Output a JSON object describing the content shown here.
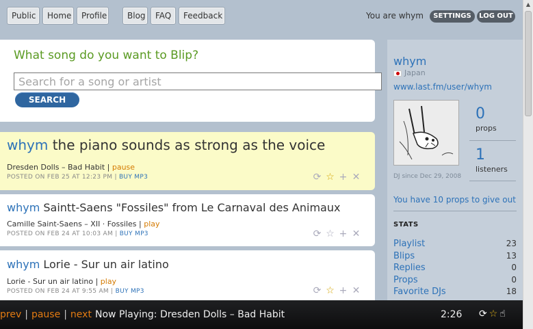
{
  "nav": {
    "public": "Public",
    "home": "Home",
    "profile": "Profile",
    "blog": "Blog",
    "faq": "FAQ",
    "feedback": "Feedback",
    "greeting": "You are whym",
    "settings": "SETTINGS",
    "logout": "LOG OUT"
  },
  "search": {
    "heading": "What song do you want to Blip?",
    "placeholder": "Search for a song or artist",
    "button": "SEARCH"
  },
  "posts": [
    {
      "dj": "whym",
      "message": "the piano sounds as strong as the voice",
      "song": "Dresden Dolls – Bad Habit",
      "action": "pause",
      "posted": "POSTED ON FEB 25 AT 12:23 PM",
      "buy": "BUY MP3",
      "favorited": true
    },
    {
      "dj": "whym",
      "message": "Saintt-Saens \"Fossiles\" from Le Carnaval des Animaux",
      "song": "Camille Saint-Saens – XII · Fossiles",
      "action": "play",
      "posted": "POSTED ON FEB 24 AT 10:03 AM",
      "buy": "BUY MP3",
      "favorited": false
    },
    {
      "dj": "whym",
      "message": "Lorie - Sur un air latino",
      "song": "Lorie - Sur un air latino",
      "action": "play",
      "posted": "POSTED ON FEB 24 AT 9:55 AM",
      "buy": "BUY MP3",
      "favorited": true
    }
  ],
  "sidebar": {
    "name": "whym",
    "country": "Japan",
    "lastfm": "www.last.fm/user/whym",
    "props_count": "0",
    "props_label": "props",
    "listeners_count": "1",
    "listeners_label": "listeners",
    "since": "DJ since Dec 29, 2008",
    "props_give": "You have 10 props to give out",
    "stats_heading": "STATS",
    "stats": [
      {
        "label": "Playlist",
        "value": "23"
      },
      {
        "label": "Blips",
        "value": "13"
      },
      {
        "label": "Replies",
        "value": "0"
      },
      {
        "label": "Props",
        "value": "0"
      },
      {
        "label": "Favorite DJs",
        "value": "18"
      }
    ]
  },
  "player": {
    "prev": "prev",
    "pause": "pause",
    "next": "next",
    "sep": "|",
    "now_playing": "Now Playing: Dresden Dolls – Bad Habit",
    "time": "2:26"
  },
  "icons": {
    "reblip": "reblip-icon",
    "favorite": "star-icon",
    "add": "plus-icon",
    "remove": "close-icon",
    "props": "thumb-up-icon"
  },
  "colors": {
    "accent": "#2d72b8",
    "action": "#d47a00",
    "heading_green": "#5a9a22",
    "active_post": "#fbfbc8"
  }
}
